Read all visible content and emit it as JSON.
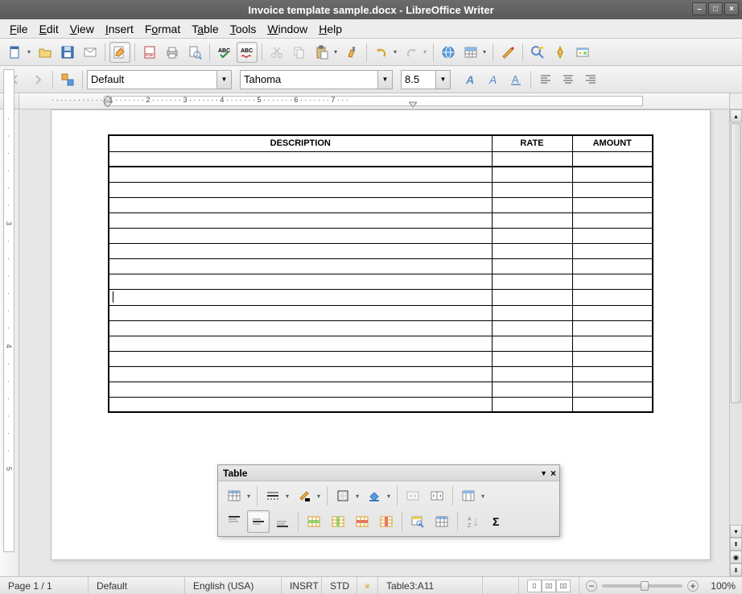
{
  "window": {
    "title": "Invoice template sample.docx - LibreOffice Writer"
  },
  "menu": {
    "file": "File",
    "edit": "Edit",
    "view": "View",
    "insert": "Insert",
    "format": "Format",
    "table": "Table",
    "tools": "Tools",
    "window": "Window",
    "help": "Help"
  },
  "formatbar": {
    "style": "Default",
    "font": "Tahoma",
    "size": "8.5"
  },
  "table_panel": {
    "title": "Table"
  },
  "document": {
    "headers": {
      "description": "DESCRIPTION",
      "rate": "RATE",
      "amount": "AMOUNT"
    },
    "row_count": 17,
    "cursor_row": 10
  },
  "statusbar": {
    "page": "Page 1 / 1",
    "style": "Default",
    "language": "English (USA)",
    "insert": "INSRT",
    "selmode": "STD",
    "cellref": "Table3:A11",
    "zoom": "100%"
  }
}
